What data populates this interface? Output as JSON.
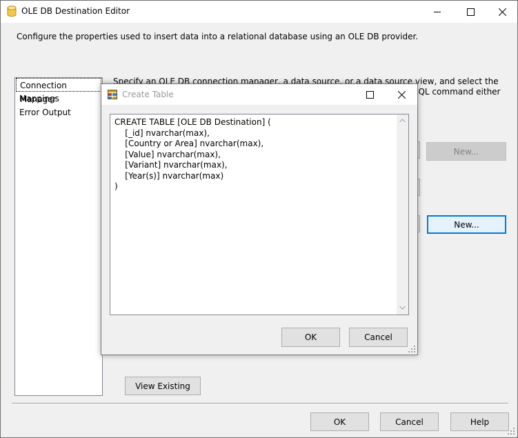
{
  "window": {
    "title": "OLE DB Destination Editor",
    "description": "Configure the properties used to insert data into a relational database using an OLE DB provider."
  },
  "nav": {
    "items": [
      {
        "label": "Connection Manager"
      },
      {
        "label": "Mappings"
      },
      {
        "label": "Error Output"
      }
    ]
  },
  "help_text": "Specify an OLE DB connection manager, a data source, or a data source view, and select the data access mode. If using the SQL command access mode, specify the SQL command either by typing the query or by",
  "buttons": {
    "new_disabled": "New...",
    "new": "New...",
    "view_existing": "View Existing",
    "ok": "OK",
    "cancel": "Cancel",
    "help": "Help"
  },
  "dialog": {
    "title": "Create Table",
    "sql": "CREATE TABLE [OLE DB Destination] (\n    [_id] nvarchar(max),\n    [Country or Area] nvarchar(max),\n    [Value] nvarchar(max),\n    [Variant] nvarchar(max),\n    [Year(s)] nvarchar(max)\n)",
    "ok": "OK",
    "cancel": "Cancel"
  },
  "icons": {
    "app": "database-cylinder-icon",
    "dialog": "table-icon"
  }
}
